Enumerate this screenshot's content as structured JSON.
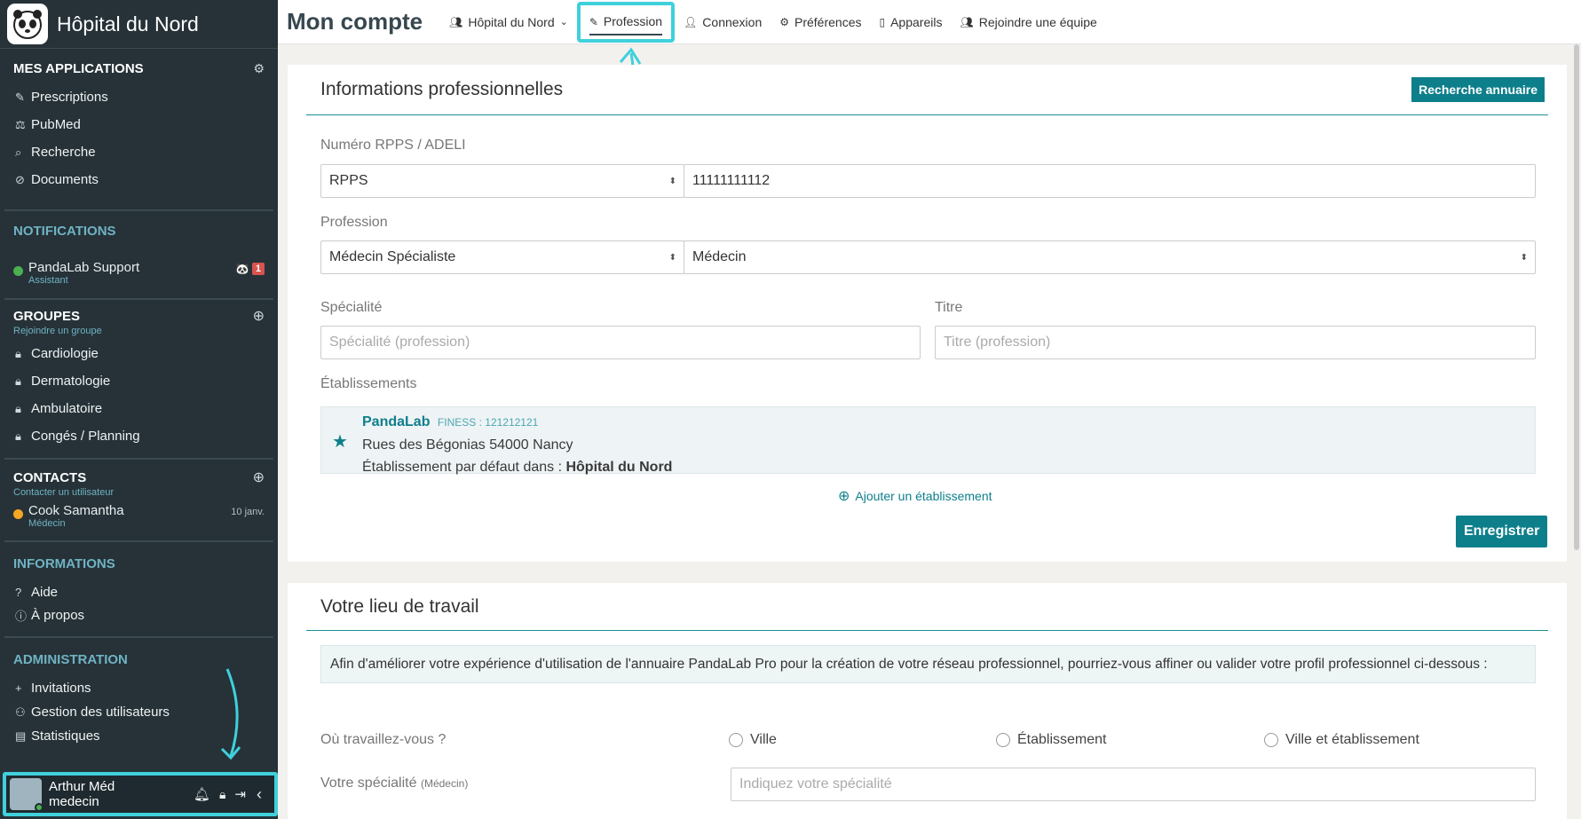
{
  "sidebar": {
    "brand": "Hôpital du Nord",
    "apps": {
      "title": "MES APPLICATIONS",
      "items": [
        {
          "label": "Prescriptions",
          "icon": "prescription-icon"
        },
        {
          "label": "PubMed",
          "icon": "pubmed-icon"
        },
        {
          "label": "Recherche",
          "icon": "search-icon"
        },
        {
          "label": "Documents",
          "icon": "paperclip-icon"
        }
      ]
    },
    "notifications": {
      "title": "NOTIFICATIONS",
      "items": [
        {
          "name": "PandaLab Support",
          "sub": "Assistant",
          "badge": "1"
        }
      ]
    },
    "groups": {
      "title": "GROUPES",
      "subtitle": "Rejoindre un groupe",
      "items": [
        "Cardiologie",
        "Dermatologie",
        "Ambulatoire",
        "Congés / Planning"
      ]
    },
    "contacts": {
      "title": "CONTACTS",
      "subtitle": "Contacter un utilisateur",
      "items": [
        {
          "name": "Cook Samantha",
          "sub": "Médecin",
          "date": "10 janv."
        }
      ]
    },
    "informations": {
      "title": "INFORMATIONS",
      "items": [
        {
          "label": "Aide",
          "icon": "help-icon"
        },
        {
          "label": "À propos",
          "icon": "info-icon"
        }
      ]
    },
    "administration": {
      "title": "ADMINISTRATION",
      "items": [
        {
          "label": "Invitations",
          "icon": "plus-icon"
        },
        {
          "label": "Gestion des utilisateurs",
          "icon": "users-icon"
        },
        {
          "label": "Statistiques",
          "icon": "stats-icon"
        }
      ]
    },
    "user": {
      "name": "Arthur Méd",
      "role": "medecin"
    }
  },
  "header": {
    "title": "Mon compte",
    "tabs": [
      {
        "label": "Hôpital du Nord",
        "icon": "team-icon"
      },
      {
        "label": "Profession",
        "icon": "profession-icon"
      },
      {
        "label": "Connexion",
        "icon": "user-icon"
      },
      {
        "label": "Préférences",
        "icon": "gear-icon"
      },
      {
        "label": "Appareils",
        "icon": "device-icon"
      },
      {
        "label": "Rejoindre une équipe",
        "icon": "join-team-icon"
      }
    ]
  },
  "pro": {
    "title": "Informations professionnelles",
    "directory_button": "Recherche annuaire",
    "rpps_label": "Numéro RPPS / ADELI",
    "rpps_type": "RPPS",
    "rpps_value": "11111111112",
    "profession_label": "Profession",
    "profession_category": "Médecin Spécialiste",
    "profession_value": "Médecin",
    "specialite_label": "Spécialité",
    "specialite_placeholder": "Spécialité (profession)",
    "titre_label": "Titre",
    "titre_placeholder": "Titre (profession)",
    "etab_label": "Établissements",
    "etab": {
      "name": "PandaLab",
      "finess": "FINESS : 121212121",
      "address": "Rues des Bégonias 54000 Nancy",
      "default_prefix": "Établissement par défaut dans : ",
      "default_in": "Hôpital du Nord"
    },
    "add_etab": "Ajouter un établissement",
    "save_button": "Enregistrer"
  },
  "work": {
    "title": "Votre lieu de travail",
    "info": "Afin d'améliorer votre expérience d'utilisation de l'annuaire PandaLab Pro pour la création de votre réseau professionnel, pourriez-vous affiner ou valider votre profil professionnel ci-dessous :",
    "where_label": "Où travaillez-vous ?",
    "options": [
      "Ville",
      "Établissement",
      "Ville et établissement"
    ],
    "specialite_label": "Votre spécialité",
    "specialite_sub": "(Médecin)",
    "specialite_placeholder": "Indiquez votre spécialité"
  },
  "colors": {
    "accent": "#0d7f8b",
    "sidebar": "#263238",
    "highlight": "#3fd0dc"
  }
}
